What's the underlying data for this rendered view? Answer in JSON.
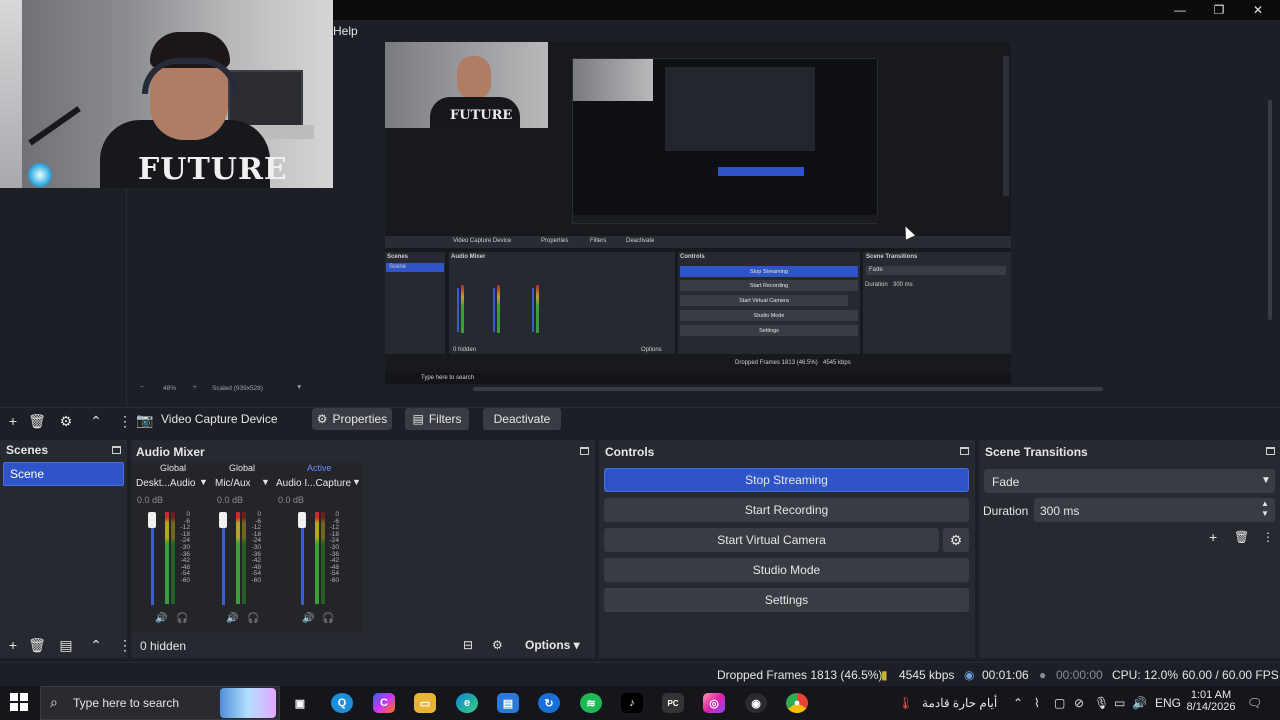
{
  "menu": {
    "help": "Help"
  },
  "window": {
    "minimize": "—",
    "maximize": "❐",
    "close": "✕"
  },
  "webcam": {
    "shirt_text": "FUTURE"
  },
  "nested_preview": {
    "sources": "Video Capture Device",
    "properties": "Properties",
    "filters": "Filters",
    "deactivate": "Deactivate",
    "scenes": "Scenes",
    "scene": "Scene",
    "audio_mixer": "Audio Mixer",
    "controls": "Controls",
    "stop_streaming": "Stop Streaming",
    "start_recording": "Start Recording",
    "start_virtual_camera": "Start Virtual Camera",
    "studio_mode": "Studio Mode",
    "settings": "Settings",
    "scene_transitions": "Scene Transitions",
    "fade": "Fade",
    "duration": "Duration",
    "duration_value": "300 ms",
    "hidden": "0 hidden",
    "options": "Options",
    "search": "Type here to search",
    "dropped": "Dropped Frames 1813 (46.5%)",
    "kbps": "4545 kbps"
  },
  "zoom": {
    "percent": "48%",
    "scaled": "Scaled (939x528)"
  },
  "source_toolbar": {
    "source_name": "Video Capture Device",
    "properties": "Properties",
    "filters": "Filters",
    "deactivate": "Deactivate"
  },
  "scenes": {
    "title": "Scenes",
    "items": [
      "Scene"
    ]
  },
  "mixer": {
    "title": "Audio Mixer",
    "channels": [
      {
        "tag": "Global",
        "name": "Deskt...Audio",
        "db": "0.0 dB"
      },
      {
        "tag": "Global",
        "name": "Mic/Aux",
        "db": "0.0 dB"
      },
      {
        "tag": "Active",
        "name": "Audio I...Capture",
        "db": "0.0 dB"
      }
    ],
    "scale": [
      "0",
      "-6",
      "-12",
      "-18",
      "-24",
      "-30",
      "-36",
      "-42",
      "-48",
      "-54",
      "-60"
    ],
    "hidden": "0 hidden",
    "options": "Options"
  },
  "controls": {
    "title": "Controls",
    "stop_streaming": "Stop Streaming",
    "start_recording": "Start Recording",
    "start_virtual_camera": "Start Virtual Camera",
    "studio_mode": "Studio Mode",
    "settings": "Settings"
  },
  "transitions": {
    "title": "Scene Transitions",
    "selected": "Fade",
    "duration_label": "Duration",
    "duration_value": "300 ms"
  },
  "status": {
    "dropped_frames": "Dropped Frames 1813 (46.5%)",
    "bitrate": "4545 kbps",
    "stream_time": "00:01:06",
    "record_time": "00:00:00",
    "cpu": "CPU: 12.0%",
    "fps": "60.00 / 60.00 FPS"
  },
  "taskbar": {
    "search_placeholder": "Type here to search",
    "weather": "أيام حارة قادمة",
    "language": "ENG",
    "time": "1:01 AM",
    "date": "8/14/2026"
  },
  "colors": {
    "accent": "#2f54c7",
    "bg": "#1d1f26",
    "dock": "#272930",
    "button": "#3a3c44"
  }
}
